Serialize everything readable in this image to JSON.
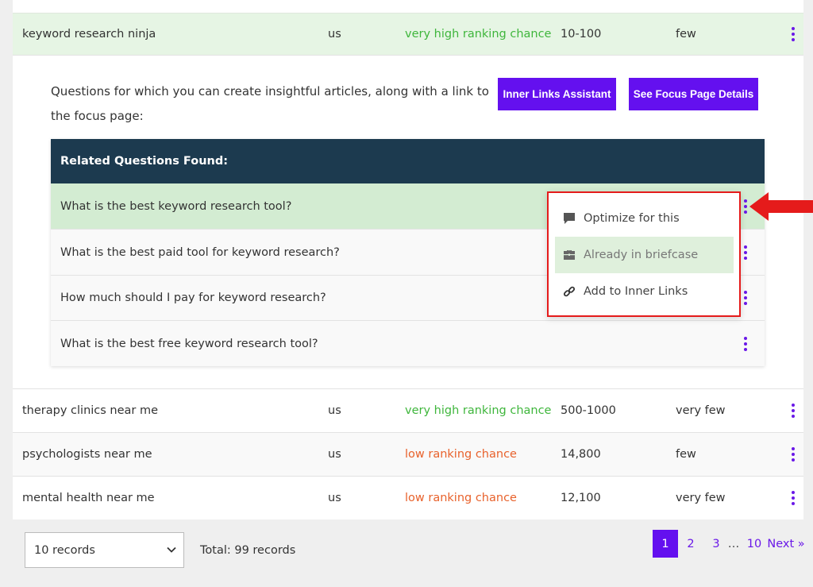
{
  "keywords": [
    {
      "keyword": "keyword research ninja",
      "location": "us",
      "chance": "very high ranking chance",
      "volume": "10-100",
      "competition": "few"
    },
    {
      "keyword": "therapy clinics near me",
      "location": "us",
      "chance": "very high ranking chance",
      "volume": "500-1000",
      "competition": "very few"
    },
    {
      "keyword": "psychologists near me",
      "location": "us",
      "chance": "low ranking chance",
      "volume": "14,800",
      "competition": "few"
    },
    {
      "keyword": "mental health near me",
      "location": "us",
      "chance": "low ranking chance",
      "volume": "12,100",
      "competition": "very few"
    }
  ],
  "expanded": {
    "intro": "Questions for which you can create insightful articles, along with a link to the focus page:",
    "inner_links_button": "Inner Links Assistant",
    "focus_page_button": "See Focus Page Details",
    "questions_header": "Related Questions Found:",
    "questions": [
      "What is the best keyword research tool?",
      "What is the best paid tool for keyword research?",
      "How much should I pay for keyword research?",
      "What is the best free keyword research tool?"
    ]
  },
  "context_menu": {
    "items": [
      {
        "label": "Optimize for this",
        "icon": "comment-icon"
      },
      {
        "label": "Already in briefcase",
        "icon": "briefcase-icon",
        "disabled": true
      },
      {
        "label": "Add to Inner Links",
        "icon": "link-icon"
      }
    ]
  },
  "footer": {
    "records_select": "10 records",
    "total": "Total: 99 records",
    "pagination": {
      "pages": [
        "1",
        "2",
        "3",
        "…",
        "10"
      ],
      "current": "1",
      "next": "Next »"
    }
  },
  "colors": {
    "accent": "#6410ef",
    "high_chance": "#3fb63c",
    "low_chance": "#e8622c",
    "header_bg": "#1c3a4f",
    "highlight_row": "#e6f5e4",
    "annotation": "#e51b1b"
  }
}
